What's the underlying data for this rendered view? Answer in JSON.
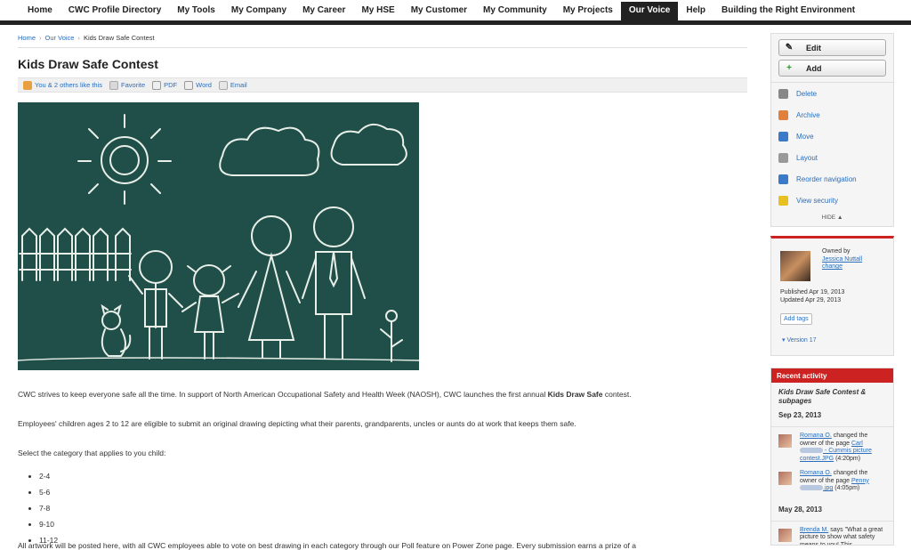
{
  "nav": {
    "items": [
      "Home",
      "CWC Profile Directory",
      "My Tools",
      "My Company",
      "My Career",
      "My HSE",
      "My Customer",
      "My Community",
      "My Projects",
      "Our Voice",
      "Help",
      "Building the Right Environment"
    ],
    "active_index": 9
  },
  "breadcrumb": {
    "home": "Home",
    "section": "Our Voice",
    "current": "Kids Draw Safe Contest"
  },
  "page": {
    "title": "Kids Draw Safe Contest",
    "actions": {
      "like": "You & 2 others like this",
      "favorite": "Favorite",
      "pdf": "PDF",
      "word": "Word",
      "email": "Email"
    },
    "para1_a": "CWC strives to keep everyone safe all the time. In support of North American Occupational Safety and Health Week (NAOSH), CWC launches the first annual ",
    "para1_b": "Kids Draw Safe",
    "para1_c": " contest.",
    "para2": "Employees' children ages 2 to 12 are eligible to submit an original drawing depicting what their parents, grandparents, uncles or aunts do at work that keeps them safe.",
    "para3": "Select the category that applies to you child:",
    "categories": [
      "2-4",
      "5-6",
      "7-8",
      "9-10",
      "11-12"
    ],
    "cutoff": "All artwork will be posted here, with all CWC employees able to vote on best drawing in each category through our Poll feature on Power Zone page. Every submission earns a prize of a"
  },
  "sidebar": {
    "edit_label": "Edit",
    "add_label": "Add",
    "menu": [
      "Delete",
      "Archive",
      "Move",
      "Layout",
      "Reorder navigation",
      "View security"
    ],
    "hide_label": "HIDE ▲",
    "owner": {
      "owned_by": "Owned by",
      "name": "Jessica Nuttall",
      "change": "change",
      "published": "Published Apr 19, 2013",
      "updated": "Updated Apr 29, 2013",
      "add_tags": "Add tags",
      "version": "▾ Version 17"
    },
    "recent": {
      "title": "Recent activity",
      "subtitle": "Kids Draw Safe Contest & subpages",
      "date1": "Sep 23, 2013",
      "item1": {
        "user": "Romana O.",
        "text": " changed the owner of the page ",
        "link": "Carl",
        "link2": " - Cummis picture contest.JPG",
        "time": " (4:20pm)"
      },
      "item2": {
        "user": "Romana O.",
        "text": " changed the owner of the page ",
        "link": "Penny",
        "link2": ".jpg",
        "time": " (4:05pm)"
      },
      "date2": "May 28, 2013",
      "item3": {
        "user": "Brenda M.",
        "text": " says \"What a great picture to show what safety means to you! This"
      }
    }
  },
  "colors": {
    "nav_bar": "#222222",
    "accent_red": "#cc2222",
    "link": "#2a6ebb",
    "chalkboard": "#1f4f48"
  }
}
